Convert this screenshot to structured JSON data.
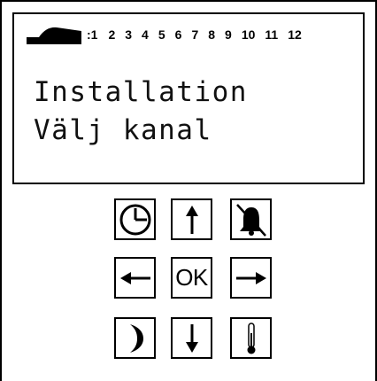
{
  "status_bar": {
    "channel_prefix": ":1",
    "channels": [
      "2",
      "3",
      "4",
      "5",
      "6",
      "7",
      "8",
      "9",
      "10",
      "11",
      "12"
    ]
  },
  "display": {
    "line1": "Installation",
    "line2": "Välj kanal"
  },
  "keypad": {
    "ok_label": "OK",
    "icons": {
      "clock": "clock-icon",
      "up": "arrow-up-icon",
      "alarm_off": "bell-off-icon",
      "left": "arrow-left-icon",
      "right": "arrow-right-icon",
      "night": "moon-icon",
      "down": "arrow-down-icon",
      "temperature": "thermometer-icon"
    }
  }
}
